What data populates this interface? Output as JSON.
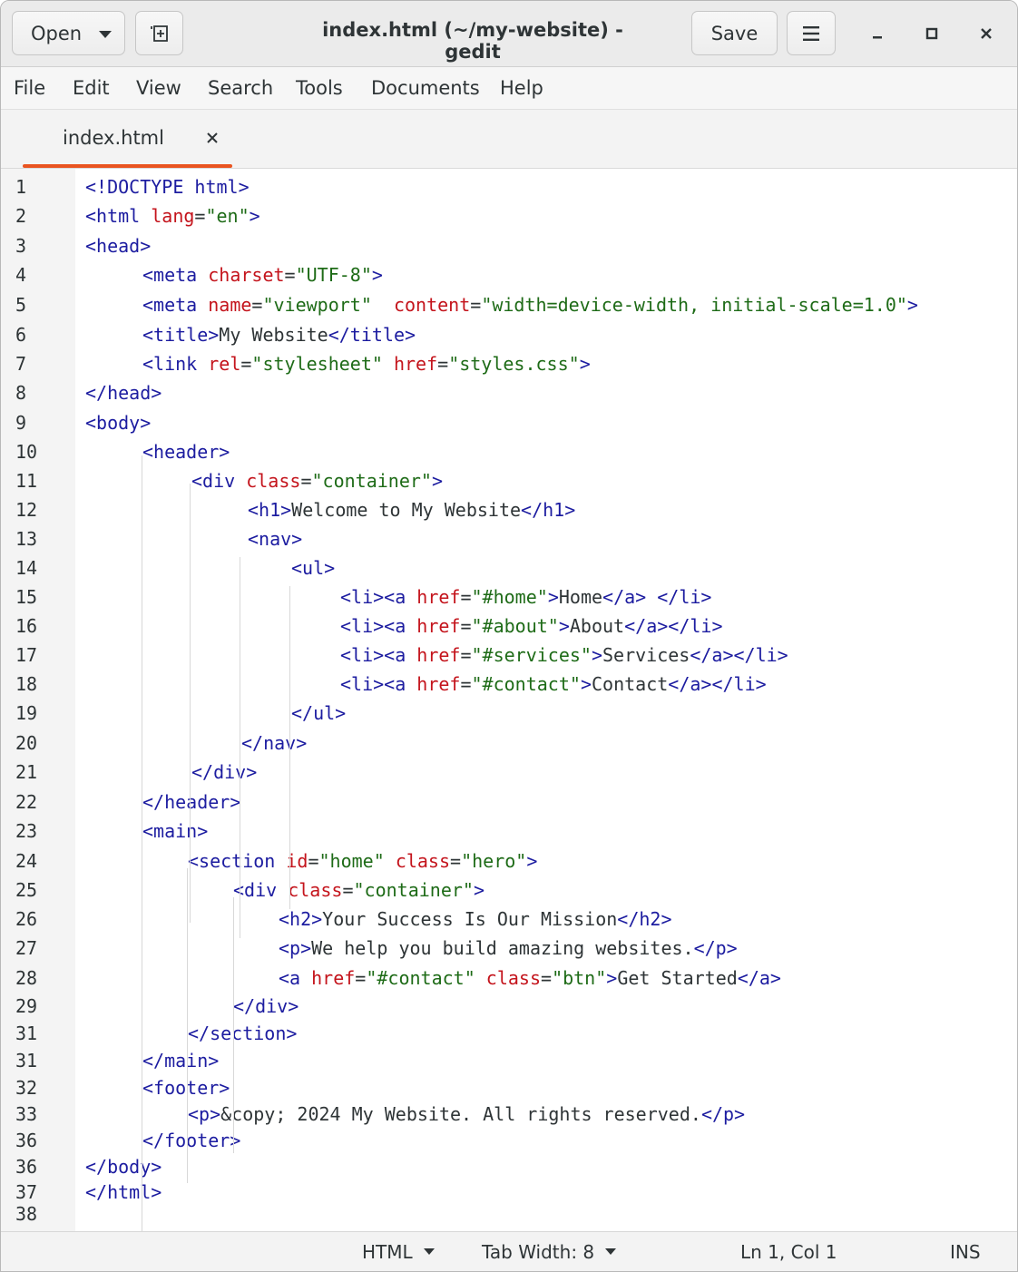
{
  "window": {
    "title": "index.html (~/my-website) - gedit"
  },
  "headerbar": {
    "open_label": "Open",
    "save_label": "Save"
  },
  "menubar": {
    "items": [
      "File",
      "Edit",
      "View",
      "Search",
      "Tools",
      "Documents",
      "Help"
    ]
  },
  "tabs": [
    {
      "label": "index.html",
      "active": true
    }
  ],
  "colors": {
    "accent": "#e95420",
    "tag": "#1c1ca0",
    "attribute": "#c4141c",
    "value": "#1e6b17",
    "text": "#2e3436"
  },
  "editor": {
    "lines": [
      {
        "no": "1",
        "tokens": [
          [
            "tag",
            "<!DOCTYPE html>"
          ]
        ]
      },
      {
        "no": "2",
        "tokens": [
          [
            "tag",
            "<html "
          ],
          [
            "attr",
            "lang"
          ],
          [
            "text",
            "="
          ],
          [
            "val",
            "\"en\""
          ],
          [
            "tag",
            ">"
          ]
        ]
      },
      {
        "no": "3",
        "tokens": [
          [
            "tag",
            "<head>"
          ]
        ]
      },
      {
        "no": "4",
        "tokens": [
          [
            "tag",
            "<meta "
          ],
          [
            "attr",
            "charset"
          ],
          [
            "text",
            "="
          ],
          [
            "val",
            "\"UTF-8\""
          ],
          [
            "tag",
            ">"
          ]
        ]
      },
      {
        "no": "5",
        "tokens": [
          [
            "tag",
            "<meta "
          ],
          [
            "attr",
            "name"
          ],
          [
            "text",
            "="
          ],
          [
            "val",
            "\"viewport\"  "
          ],
          [
            "attr",
            "content"
          ],
          [
            "text",
            "="
          ],
          [
            "val",
            "\"width=device-width, initial-scale=1.0\""
          ],
          [
            "tag",
            ">"
          ]
        ]
      },
      {
        "no": "6",
        "tokens": [
          [
            "tag",
            "<title>"
          ],
          [
            "text",
            "My Website"
          ],
          [
            "tag",
            "</title>"
          ]
        ]
      },
      {
        "no": "7",
        "tokens": [
          [
            "tag",
            "<link "
          ],
          [
            "attr",
            "rel"
          ],
          [
            "text",
            "="
          ],
          [
            "val",
            "\"stylesheet\" "
          ],
          [
            "attr",
            "href"
          ],
          [
            "text",
            "="
          ],
          [
            "val",
            "\"styles.css\""
          ],
          [
            "tag",
            ">"
          ]
        ]
      },
      {
        "no": "8",
        "tokens": [
          [
            "tag",
            "</head>"
          ]
        ]
      },
      {
        "no": "9",
        "tokens": [
          [
            "tag",
            "<body>"
          ]
        ]
      },
      {
        "no": "10",
        "tokens": [
          [
            "tag",
            "<header>"
          ]
        ]
      },
      {
        "no": "11",
        "tokens": [
          [
            "tag",
            "<div "
          ],
          [
            "attr",
            "class"
          ],
          [
            "text",
            "="
          ],
          [
            "val",
            "\"container\""
          ],
          [
            "tag",
            ">"
          ]
        ]
      },
      {
        "no": "12",
        "tokens": [
          [
            "tag",
            "<h1>"
          ],
          [
            "text",
            "Welcome to My Website"
          ],
          [
            "tag",
            "</h1>"
          ]
        ]
      },
      {
        "no": "13",
        "tokens": [
          [
            "tag",
            "<nav>"
          ]
        ]
      },
      {
        "no": "14",
        "tokens": [
          [
            "tag",
            "<ul>"
          ]
        ]
      },
      {
        "no": "15",
        "tokens": [
          [
            "tag",
            "<li><a "
          ],
          [
            "attr",
            "href"
          ],
          [
            "text",
            "="
          ],
          [
            "val",
            "\"#home\""
          ],
          [
            "tag",
            ">"
          ],
          [
            "text",
            "Home"
          ],
          [
            "tag",
            "</a> </li>"
          ]
        ]
      },
      {
        "no": "16",
        "tokens": [
          [
            "tag",
            "<li><a "
          ],
          [
            "attr",
            "href"
          ],
          [
            "text",
            "="
          ],
          [
            "val",
            "\"#about\""
          ],
          [
            "tag",
            ">"
          ],
          [
            "text",
            "About"
          ],
          [
            "tag",
            "</a></li>"
          ]
        ]
      },
      {
        "no": "17",
        "tokens": [
          [
            "tag",
            "<li><a "
          ],
          [
            "attr",
            "href"
          ],
          [
            "text",
            "="
          ],
          [
            "val",
            "\"#services\""
          ],
          [
            "tag",
            ">"
          ],
          [
            "text",
            "Services"
          ],
          [
            "tag",
            "</a></li>"
          ]
        ]
      },
      {
        "no": "18",
        "tokens": [
          [
            "tag",
            "<li><a "
          ],
          [
            "attr",
            "href"
          ],
          [
            "text",
            "="
          ],
          [
            "val",
            "\"#contact\""
          ],
          [
            "tag",
            ">"
          ],
          [
            "text",
            "Contact"
          ],
          [
            "tag",
            "</a></li>"
          ]
        ]
      },
      {
        "no": "19",
        "tokens": [
          [
            "tag",
            "</ul>"
          ]
        ]
      },
      {
        "no": "20",
        "tokens": [
          [
            "tag",
            "</nav>"
          ]
        ]
      },
      {
        "no": "21",
        "tokens": [
          [
            "tag",
            "</div>"
          ]
        ]
      },
      {
        "no": "22",
        "tokens": [
          [
            "tag",
            "</header>"
          ]
        ]
      },
      {
        "no": "23",
        "tokens": [
          [
            "tag",
            "<main>"
          ]
        ]
      },
      {
        "no": "24",
        "tokens": [
          [
            "tag",
            "<section "
          ],
          [
            "attr",
            "id"
          ],
          [
            "text",
            "="
          ],
          [
            "val",
            "\"home\" "
          ],
          [
            "attr",
            "class"
          ],
          [
            "text",
            "="
          ],
          [
            "val",
            "\"hero\""
          ],
          [
            "tag",
            ">"
          ]
        ]
      },
      {
        "no": "25",
        "tokens": [
          [
            "tag",
            "<div "
          ],
          [
            "attr",
            "class"
          ],
          [
            "text",
            "="
          ],
          [
            "val",
            "\"container\""
          ],
          [
            "tag",
            ">"
          ]
        ]
      },
      {
        "no": "26",
        "tokens": [
          [
            "tag",
            "<h2>"
          ],
          [
            "text",
            "Your Success Is Our Mission"
          ],
          [
            "tag",
            "</h2>"
          ]
        ]
      },
      {
        "no": "27",
        "tokens": [
          [
            "tag",
            "<p>"
          ],
          [
            "text",
            "We help you build amazing websites."
          ],
          [
            "tag",
            "</p>"
          ]
        ]
      },
      {
        "no": "28",
        "tokens": [
          [
            "tag",
            "<a "
          ],
          [
            "attr",
            "href"
          ],
          [
            "text",
            "="
          ],
          [
            "val",
            "\"#contact\" "
          ],
          [
            "attr",
            "class"
          ],
          [
            "text",
            "="
          ],
          [
            "val",
            "\"btn\""
          ],
          [
            "tag",
            ">"
          ],
          [
            "text",
            "Get Started"
          ],
          [
            "tag",
            "</a>"
          ]
        ]
      },
      {
        "no": "29",
        "tokens": [
          [
            "tag",
            "</div>"
          ]
        ]
      },
      {
        "no": "31",
        "tokens": [
          [
            "tag",
            "</section>"
          ]
        ]
      },
      {
        "no": "31",
        "tokens": [
          [
            "tag",
            "</main>"
          ]
        ]
      },
      {
        "no": "32",
        "tokens": [
          [
            "tag",
            "<footer>"
          ]
        ]
      },
      {
        "no": "33",
        "tokens": [
          [
            "tag",
            "<p>"
          ],
          [
            "text",
            "&copy; 2024 My Website. All rights reserved."
          ],
          [
            "tag",
            "</p>"
          ]
        ]
      },
      {
        "no": "36",
        "tokens": [
          [
            "tag",
            "</footer>"
          ]
        ]
      },
      {
        "no": "36",
        "tokens": [
          [
            "tag",
            "</body>"
          ]
        ]
      },
      {
        "no": "37",
        "tokens": [
          [
            "tag",
            "</html>"
          ]
        ]
      },
      {
        "no": "38",
        "tokens": []
      }
    ]
  },
  "statusbar": {
    "language": "HTML",
    "tab_width": "Tab Width: 8",
    "cursor": "Ln 1, Col 1",
    "mode": "INS"
  }
}
